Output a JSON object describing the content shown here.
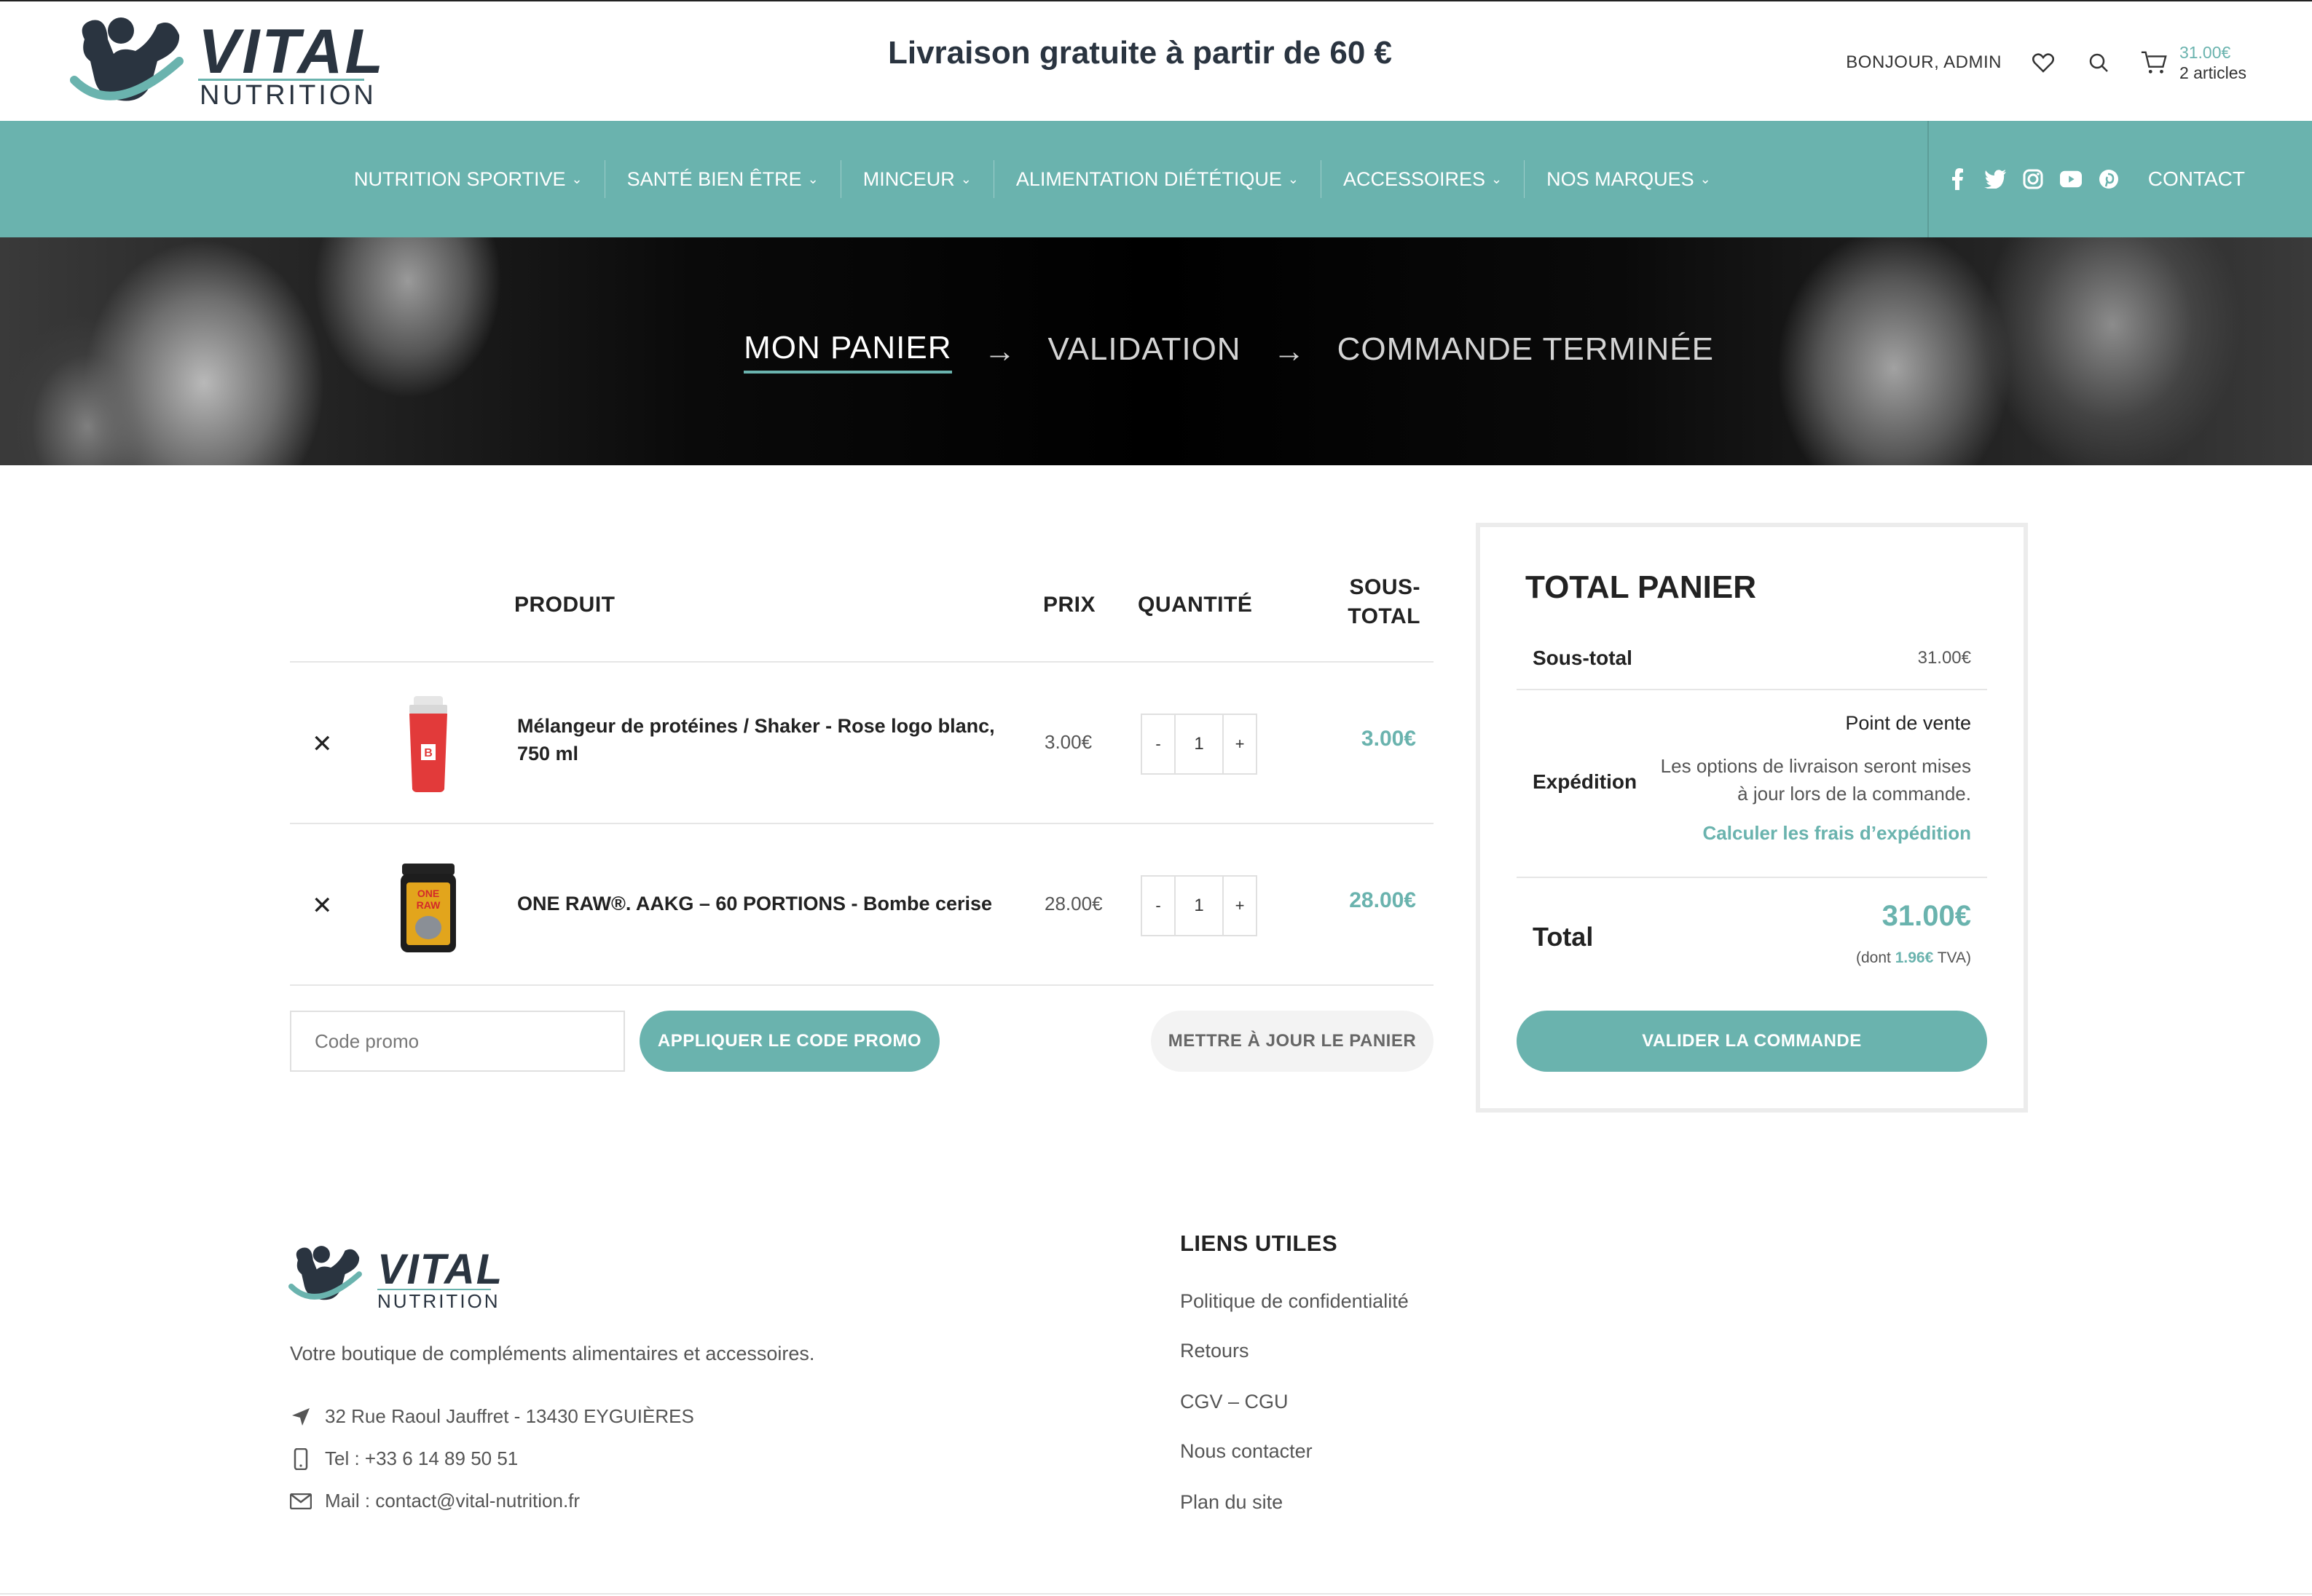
{
  "header": {
    "logo_vital": "VITAL",
    "logo_nutrition": "NUTRITION",
    "promo_banner": "Livraison gratuite à partir de 60 €",
    "greeting": "BONJOUR, ADMIN",
    "cart_total": "31.00€",
    "cart_count": "2 articles",
    "icons": [
      "heart-icon",
      "search-icon",
      "cart-icon"
    ]
  },
  "nav": {
    "items": [
      {
        "label": "NUTRITION SPORTIVE"
      },
      {
        "label": "SANTÉ BIEN ÊTRE"
      },
      {
        "label": "MINCEUR"
      },
      {
        "label": "ALIMENTATION DIÉTÉTIQUE"
      },
      {
        "label": "ACCESSOIRES"
      },
      {
        "label": "NOS MARQUES"
      }
    ],
    "chevron": "⌄",
    "socials": [
      "facebook-icon",
      "twitter-icon",
      "instagram-icon",
      "youtube-icon",
      "pinterest-icon"
    ],
    "contact": "CONTACT"
  },
  "steps": {
    "step1": "MON PANIER",
    "step2": "VALIDATION",
    "step3": "COMMANDE TERMINÉE",
    "arrow": "→"
  },
  "cart": {
    "headers": {
      "product": "PRODUIT",
      "price": "PRIX",
      "quantity": "QUANTITÉ",
      "subtotal_line1": "SOUS-",
      "subtotal_line2": "TOTAL"
    },
    "items": [
      {
        "remove": "✕",
        "name_line1": "Mélangeur de protéines / Shaker - Rose logo blanc,",
        "name_line2": "750 ml",
        "price": "3.00€",
        "qty": "1",
        "subtotal": "3.00€"
      },
      {
        "remove": "✕",
        "name_line1": "ONE RAW®. AAKG – 60 PORTIONS - Bombe cerise",
        "name_line2": "",
        "price": "28.00€",
        "qty": "1",
        "subtotal": "28.00€"
      }
    ],
    "qty_minus": "-",
    "qty_plus": "+",
    "promo_placeholder": "Code promo",
    "apply_label": "APPLIQUER LE CODE PROMO",
    "update_label": "METTRE À JOUR LE PANIER"
  },
  "totals": {
    "title": "TOTAL PANIER",
    "subtotal_label": "Sous-total",
    "subtotal_value": "31.00€",
    "shipping_label": "Expédition",
    "shipping_point": "Point de vente",
    "shipping_note": "Les options de livraison seront mises à jour lors de la commande.",
    "shipping_calc": "Calculer les frais d’expédition",
    "total_label": "Total",
    "total_value": "31.00€",
    "vat_prefix": "(dont ",
    "vat_amount": "1.96€",
    "vat_suffix": " TVA)",
    "validate_label": "VALIDER LA COMMANDE"
  },
  "footer": {
    "logo_vital": "VITAL",
    "logo_nutrition": "NUTRITION",
    "description": "Votre boutique de compléments alimentaires et accessoires.",
    "address": "32 Rue Raoul Jauffret - 13430 EYGUIÈRES",
    "phone": "Tel : +33 6 14 89 50 51",
    "mail": "Mail : contact@vital-nutrition.fr",
    "links_title": "LIENS UTILES",
    "links": [
      "Politique de confidentialité",
      "Retours",
      "CGV – CGU",
      "Nous contacter",
      "Plan du site"
    ]
  },
  "colors": {
    "accent": "#6ab3ae",
    "dark": "#2a3440"
  }
}
